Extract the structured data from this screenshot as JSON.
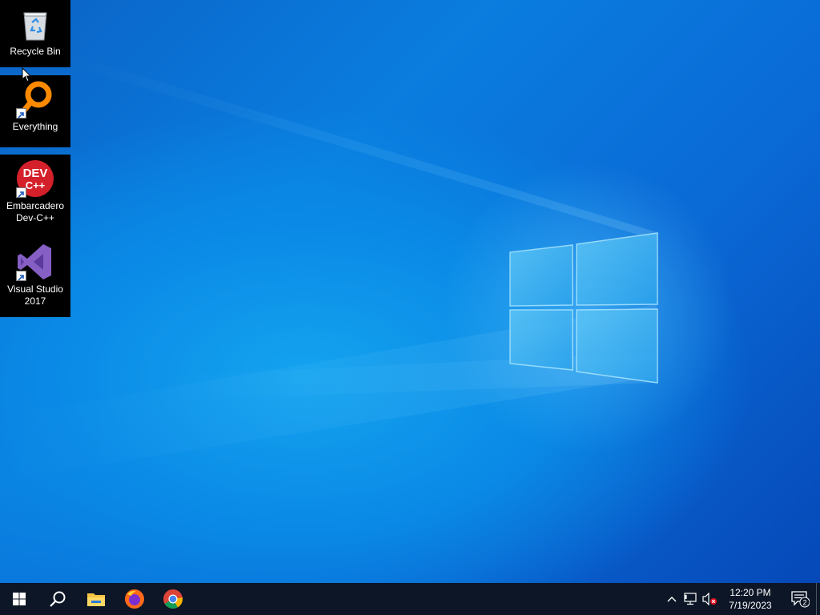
{
  "desktop": {
    "icons": [
      {
        "label": "Recycle Bin",
        "icon": "recycle-bin-icon",
        "shortcut": false
      },
      {
        "label": "Everything",
        "icon": "everything-search-icon",
        "shortcut": true
      },
      {
        "label": "Embarcadero\nDev-C++",
        "icon": "dev-cpp-icon",
        "icon_text": "DEV\nC++",
        "shortcut": true
      },
      {
        "label": "Visual Studio\n2017",
        "icon": "visual-studio-icon",
        "shortcut": true
      }
    ]
  },
  "taskbar": {
    "buttons": [
      {
        "name": "start",
        "icon": "windows-logo-icon"
      },
      {
        "name": "search",
        "icon": "search-icon"
      },
      {
        "name": "file-explorer",
        "icon": "folder-icon"
      },
      {
        "name": "firefox",
        "icon": "firefox-icon"
      },
      {
        "name": "chrome",
        "icon": "chrome-icon"
      }
    ],
    "tray": {
      "icons": [
        "chevron-up-icon",
        "network-icon",
        "volume-muted-icon"
      ],
      "time": "12:20 PM",
      "date": "7/19/2023",
      "notification_count": "2"
    }
  },
  "colors": {
    "taskbar": "#0d1626",
    "wallpaper_primary": "#0a7ddf",
    "dev_cpp_red": "#d4202a",
    "visual_studio_purple": "#865fc5",
    "everything_orange": "#ff8a00"
  }
}
